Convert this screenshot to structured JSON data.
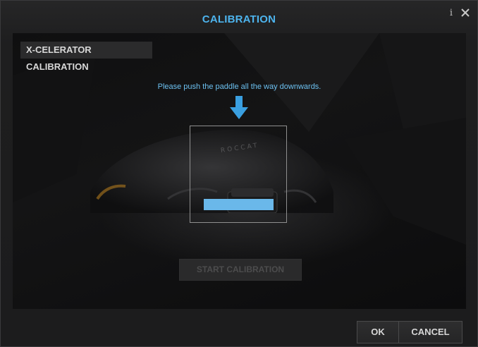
{
  "window": {
    "title": "CALIBRATION",
    "info_icon": "info-icon",
    "info_glyph": "i",
    "close_icon": "close-icon"
  },
  "section": {
    "title": "X-CELERATOR CALIBRATION"
  },
  "calibration": {
    "instruction": "Please push the paddle all the way downwards.",
    "arrow_icon": "down-arrow-icon",
    "mouse_brand_text": "ROCCAT",
    "start_button_label": "START CALIBRATION",
    "start_button_enabled": false
  },
  "footer": {
    "ok_label": "OK",
    "cancel_label": "CANCEL"
  },
  "colors": {
    "accent": "#4db4ee",
    "instruction_text": "#6cc0f0",
    "calibration_bar": "#6ab8ea",
    "background": "#1b1b1c"
  }
}
